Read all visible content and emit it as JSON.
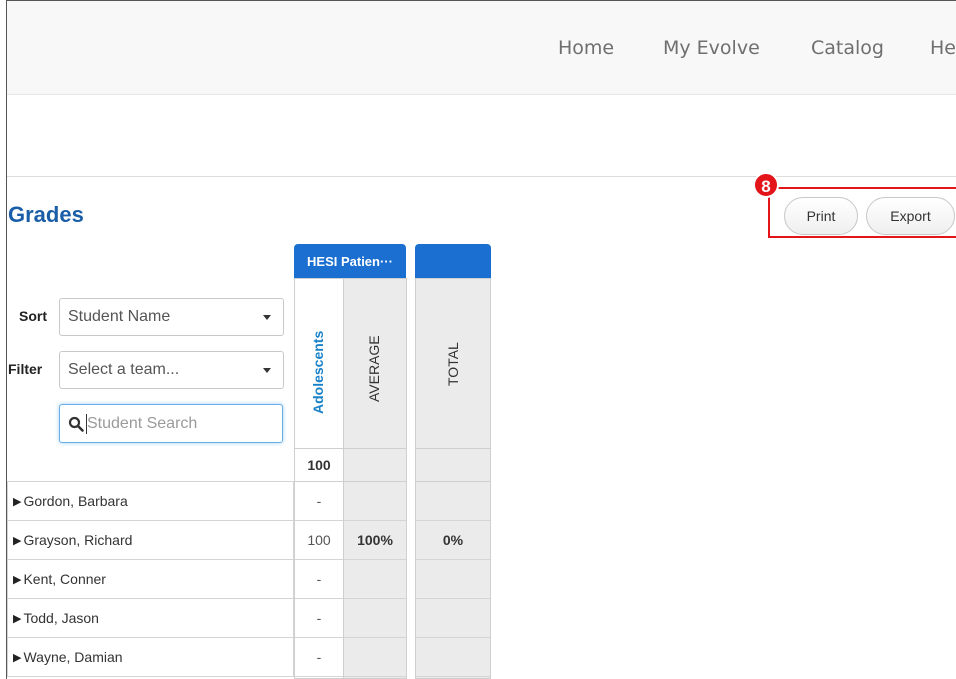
{
  "nav": {
    "links": [
      "Home",
      "My Evolve",
      "Catalog",
      "He"
    ]
  },
  "page": {
    "title": "Grades"
  },
  "callout": {
    "number": "8"
  },
  "actions": {
    "print_label": "Print",
    "export_label": "Export"
  },
  "controls": {
    "sort_label": "Sort",
    "sort_value": "Student Name",
    "filter_label": "Filter",
    "filter_value": "Select a team...",
    "search_placeholder": "Student Search"
  },
  "gradebook": {
    "groups": [
      {
        "title": "HESI Patien···",
        "color": "#1a6fd0"
      },
      {
        "title": "",
        "color": "#1a6fd0"
      }
    ],
    "columns": [
      {
        "label": "Adolescents",
        "color": "#1a82c8"
      },
      {
        "label": "AVERAGE",
        "color": "#333333"
      },
      {
        "label": "TOTAL",
        "color": "#333333"
      }
    ],
    "points_possible": "100",
    "students": [
      {
        "name": "Gordon, Barbara",
        "score": "-",
        "average": "",
        "total": ""
      },
      {
        "name": "Grayson, Richard",
        "score": "100",
        "average": "100%",
        "total": "0%"
      },
      {
        "name": "Kent, Conner",
        "score": "-",
        "average": "",
        "total": ""
      },
      {
        "name": "Todd, Jason",
        "score": "-",
        "average": "",
        "total": ""
      },
      {
        "name": "Wayne, Damian",
        "score": "-",
        "average": "",
        "total": ""
      }
    ]
  },
  "colors": {
    "title_blue": "#1a5ea8",
    "header_blue": "#1a6fd0",
    "callout_red": "#e3151a",
    "gray_column": "#ebebeb"
  }
}
